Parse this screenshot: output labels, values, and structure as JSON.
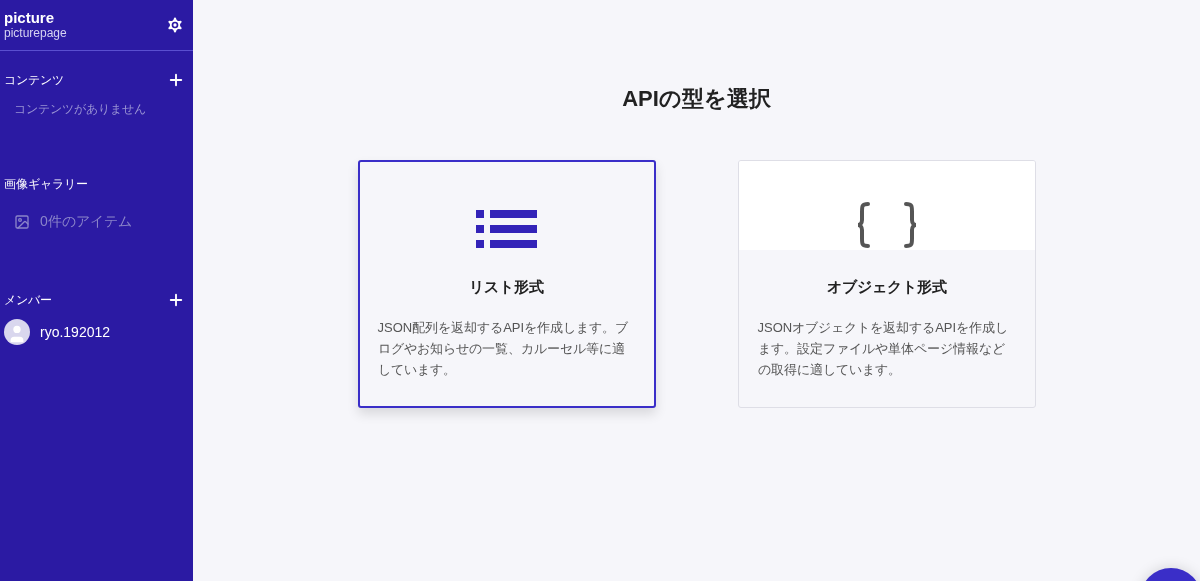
{
  "sidebar": {
    "title": "picture",
    "subtitle": "picturepage",
    "sections": [
      {
        "kind": "contents",
        "heading": "コンテンツ",
        "empty_text": "コンテンツがありません"
      },
      {
        "kind": "gallery",
        "heading": "画像ギャラリー",
        "item": "0件のアイテム"
      },
      {
        "kind": "members",
        "heading": "メンバー",
        "member": "ryo.192012"
      }
    ]
  },
  "main": {
    "heading": "APIの型を選択",
    "cards": [
      {
        "kind": "list",
        "title": "リスト形式",
        "description": "JSON配列を返却するAPIを作成します。ブログやお知らせの一覧、カルーセル等に適しています。",
        "selected": true
      },
      {
        "kind": "object",
        "title": "オブジェクト形式",
        "description": "JSONオブジェクトを返却するAPIを作成します。設定ファイルや単体ページ情報などの取得に適しています。",
        "selected": false
      }
    ]
  }
}
